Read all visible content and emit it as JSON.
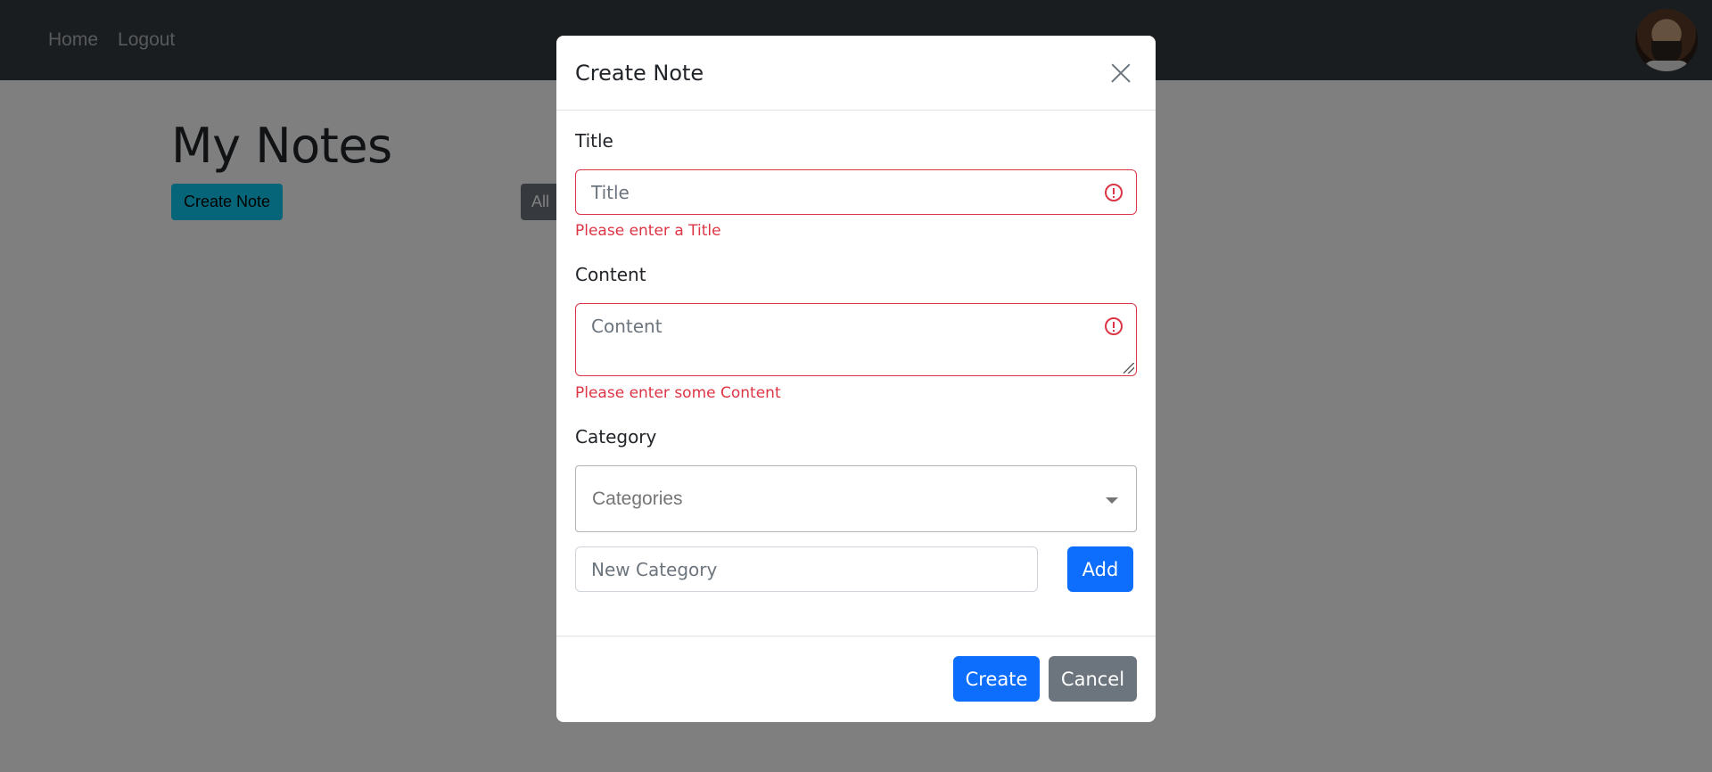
{
  "navbar": {
    "links": [
      {
        "label": "Home"
      },
      {
        "label": "Logout"
      }
    ]
  },
  "main": {
    "title": "My Notes",
    "create_note_label": "Create Note",
    "all_filter_label": "All"
  },
  "modal": {
    "title": "Create Note",
    "fields": {
      "title": {
        "label": "Title",
        "placeholder": "Title",
        "value": "",
        "error": "Please enter a Title"
      },
      "content": {
        "label": "Content",
        "placeholder": "Content",
        "value": "",
        "error": "Please enter some Content"
      },
      "category": {
        "label": "Category",
        "selected": "Categories"
      },
      "new_category": {
        "placeholder": "New Category",
        "value": "",
        "add_label": "Add"
      }
    },
    "footer": {
      "create_label": "Create",
      "cancel_label": "Cancel"
    }
  },
  "colors": {
    "navbar_bg": "#343a40",
    "primary": "#0d6efd",
    "secondary": "#6c757d",
    "info": "#0dcaf0",
    "danger": "#dc3545"
  }
}
